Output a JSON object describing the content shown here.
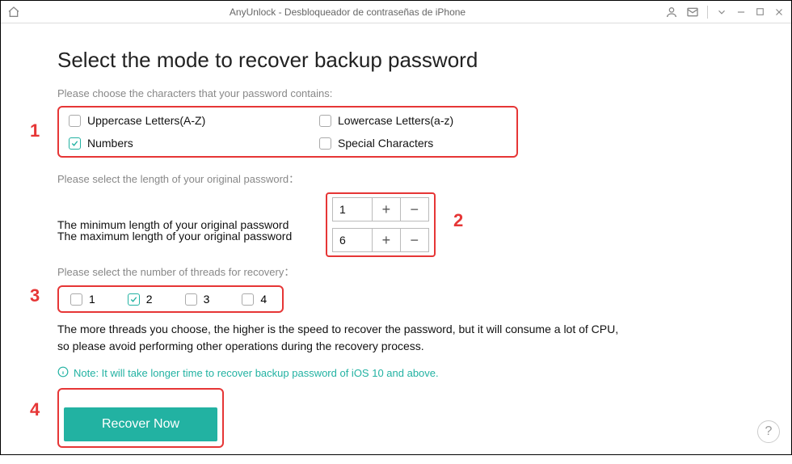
{
  "titlebar": {
    "title": "AnyUnlock - Desbloqueador de contraseñas de iPhone"
  },
  "page": {
    "title": "Select the mode to recover backup password"
  },
  "charset": {
    "prompt": "Please choose the characters that your password contains:",
    "uppercase": "Uppercase Letters(A-Z)",
    "lowercase": "Lowercase Letters(a-z)",
    "numbers": "Numbers",
    "special": "Special Characters"
  },
  "length": {
    "prompt": "Please select the length of your original password：",
    "min_label": "The minimum length of your original password",
    "max_label": "The maximum length of your original password",
    "min_value": "1",
    "max_value": "6"
  },
  "threads": {
    "prompt": "Please select the number of threads for recovery：",
    "opt1": "1",
    "opt2": "2",
    "opt3": "3",
    "opt4": "4",
    "note_line1": "The more threads you choose, the higher is the speed to recover the password, but it will consume a lot of CPU,",
    "note_line2": "so please avoid performing other operations during the recovery process."
  },
  "info_note": "Note: It will take longer time to recover backup password of iOS 10 and above.",
  "recover_button": "Recover Now",
  "help": "?",
  "annotations": {
    "n1": "1",
    "n2": "2",
    "n3": "3",
    "n4": "4"
  }
}
